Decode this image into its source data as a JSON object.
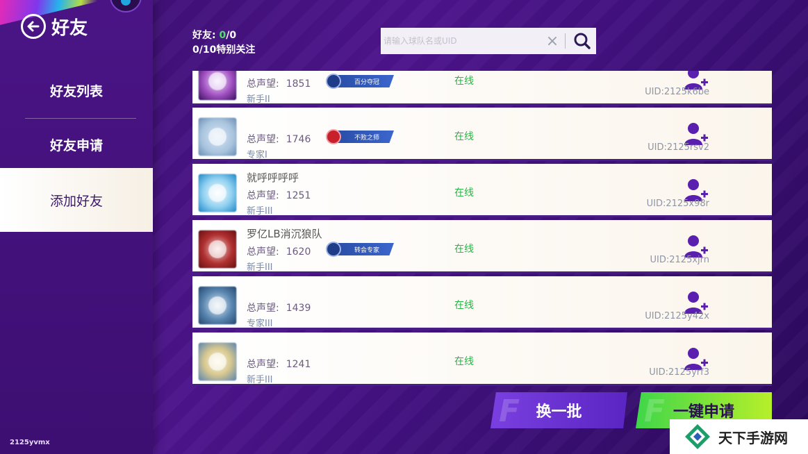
{
  "header": {
    "title": "好友"
  },
  "sidebar": {
    "items": [
      {
        "label": "好友列表"
      },
      {
        "label": "好友申请"
      },
      {
        "label": "添加好友"
      }
    ],
    "user_id": "2125yvmx"
  },
  "stats": {
    "friends_label": "好友: ",
    "friends_count": "0",
    "friends_total": "/0",
    "special_follow": "0/10特别关注"
  },
  "search": {
    "placeholder": "请输入球队名或UID"
  },
  "rows": [
    {
      "name": "",
      "fame_label": "总声望:",
      "fame": "1851",
      "rank": "新手II",
      "badge": "百分夺冠",
      "status": "在线",
      "uid": "UID:2125k6be"
    },
    {
      "name": "",
      "fame_label": "总声望:",
      "fame": "1746",
      "rank": "专家I",
      "badge": "不败之师",
      "status": "在线",
      "uid": "UID:2125rsv2"
    },
    {
      "name": "就呼呼呼呼",
      "fame_label": "总声望:",
      "fame": "1251",
      "rank": "新手III",
      "badge": "",
      "status": "在线",
      "uid": "UID:2125x98r"
    },
    {
      "name": "罗亿LB消沉狼队",
      "fame_label": "总声望:",
      "fame": "1620",
      "rank": "新手III",
      "badge": "转会专家",
      "status": "在线",
      "uid": "UID:2125xjrn"
    },
    {
      "name": "",
      "fame_label": "总声望:",
      "fame": "1439",
      "rank": "专家III",
      "badge": "",
      "status": "在线",
      "uid": "UID:2125y42x"
    },
    {
      "name": "",
      "fame_label": "总声望:",
      "fame": "1241",
      "rank": "新手III",
      "badge": "",
      "status": "在线",
      "uid": "UID:2125yrf3"
    }
  ],
  "buttons": {
    "refresh": "换一批",
    "apply_all": "一键申请"
  },
  "watermark": {
    "text": "天下手游网"
  },
  "colors": {
    "online": "#28b446",
    "accent": "#4d148c",
    "apply": "#7ddc3a"
  }
}
